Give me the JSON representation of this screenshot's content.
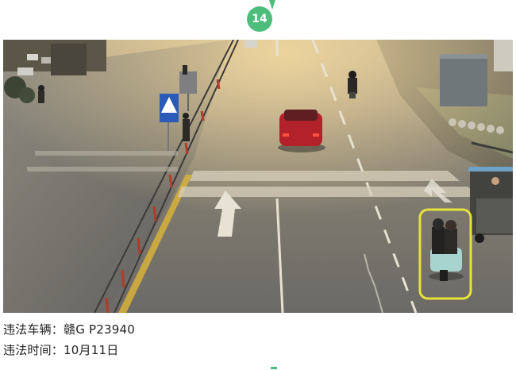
{
  "page_badge": {
    "number": "14",
    "color": "#4dbd7c"
  },
  "photo": {
    "subject": "traffic-camera-frame",
    "highlight_color": "#e8e23a"
  },
  "captions": [
    {
      "label": "违法车辆：",
      "value": "赣G P23940"
    },
    {
      "label": "违法时间：",
      "value": "10月11日"
    }
  ]
}
